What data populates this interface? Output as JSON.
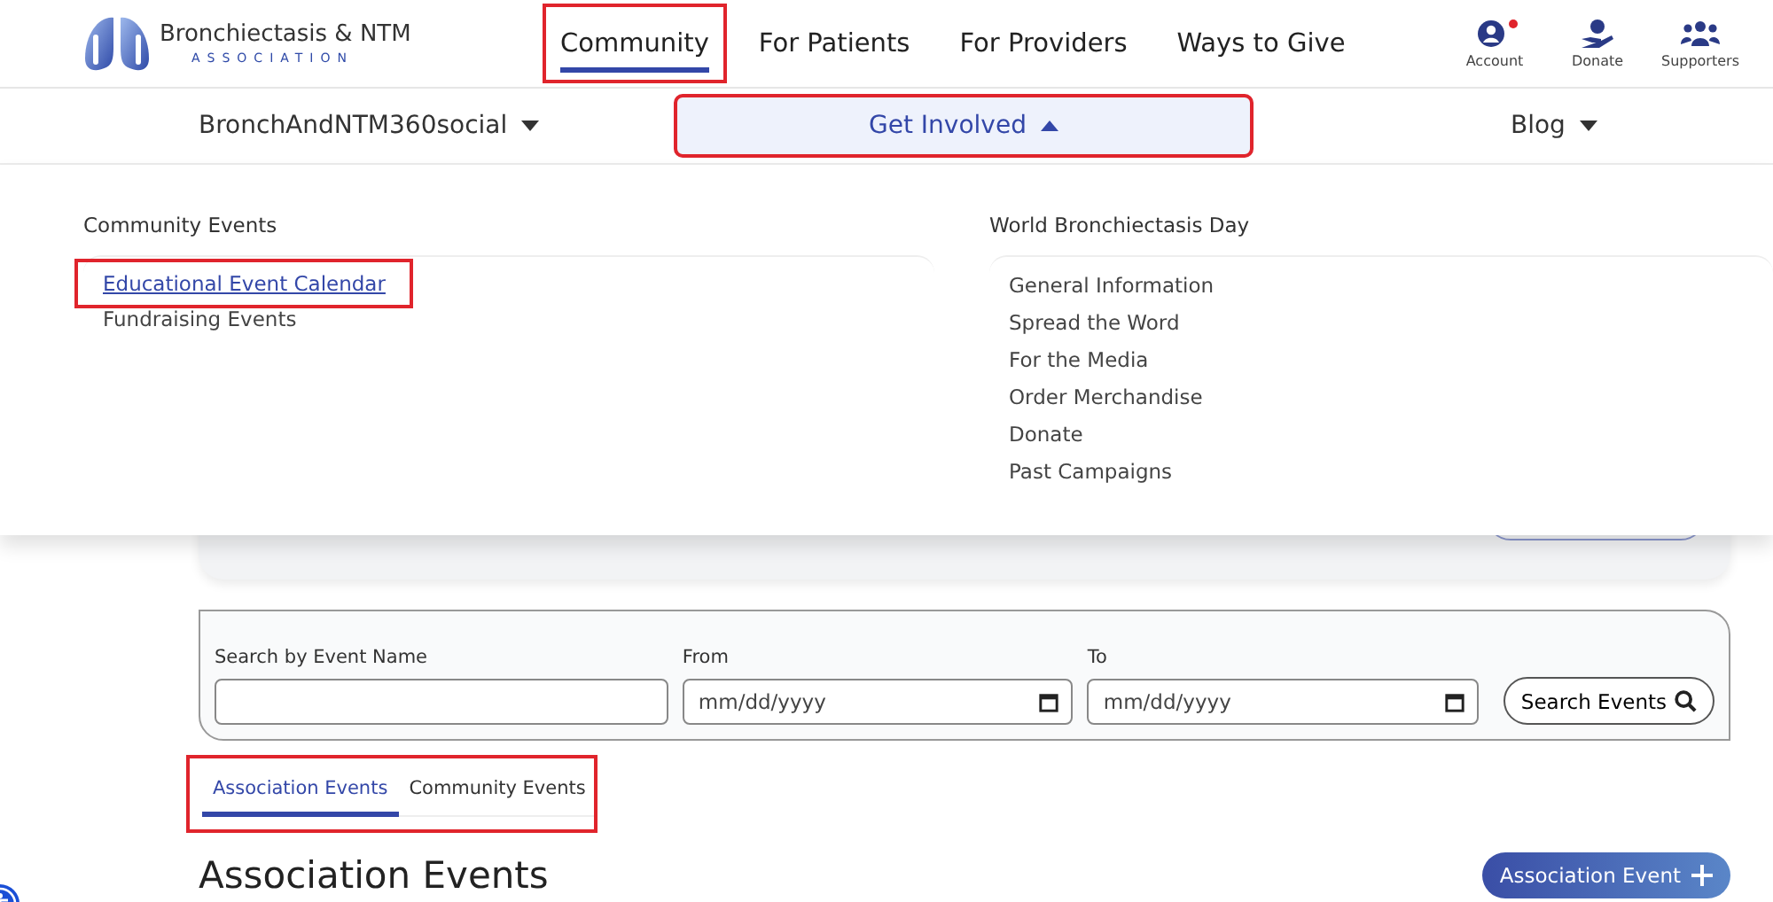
{
  "logo": {
    "name": "Bronchiectasis & NTM",
    "tagline": "ASSOCIATION"
  },
  "main_nav": [
    {
      "label": "Community",
      "selected": true,
      "highlighted": true
    },
    {
      "label": "For Patients",
      "selected": false,
      "highlighted": false
    },
    {
      "label": "For Providers",
      "selected": false,
      "highlighted": false
    },
    {
      "label": "Ways to Give",
      "selected": false,
      "highlighted": false
    }
  ],
  "utility_nav": [
    {
      "kind": "account",
      "label": "Account",
      "notification": true
    },
    {
      "kind": "donate",
      "label": "Donate",
      "notification": false
    },
    {
      "kind": "supporters",
      "label": "Supporters",
      "notification": false
    }
  ],
  "sub_nav": [
    {
      "label": "BronchAndNTM360social",
      "expanded": false,
      "highlighted": false
    },
    {
      "label": "Get Involved",
      "expanded": true,
      "highlighted": true
    },
    {
      "label": "Blog",
      "expanded": false,
      "highlighted": false
    }
  ],
  "dropdown": {
    "columns": [
      {
        "heading": "Community Events",
        "links": [
          {
            "label": "Educational Event Calendar",
            "selected": true,
            "highlighted": true
          },
          {
            "label": "Fundraising Events",
            "selected": false,
            "highlighted": false
          }
        ]
      },
      {
        "heading": "World Bronchiectasis Day",
        "links": [
          {
            "label": "General Information",
            "selected": false,
            "highlighted": false
          },
          {
            "label": "Spread the Word",
            "selected": false,
            "highlighted": false
          },
          {
            "label": "For the Media",
            "selected": false,
            "highlighted": false
          },
          {
            "label": "Order Merchandise",
            "selected": false,
            "highlighted": false
          },
          {
            "label": "Donate",
            "selected": false,
            "highlighted": false
          },
          {
            "label": "Past Campaigns",
            "selected": false,
            "highlighted": false
          }
        ]
      }
    ]
  },
  "search": {
    "name_label": "Search by Event Name",
    "from_label": "From",
    "from_placeholder": "mm/dd/yyyy",
    "to_label": "To",
    "to_placeholder": "mm/dd/yyyy",
    "button": "Search Events"
  },
  "tabs": {
    "highlighted": true,
    "items": [
      {
        "label": "Association Events",
        "selected": true
      },
      {
        "label": "Community Events",
        "selected": false
      }
    ]
  },
  "section": {
    "title": "Association Events",
    "button": "Association Event"
  }
}
